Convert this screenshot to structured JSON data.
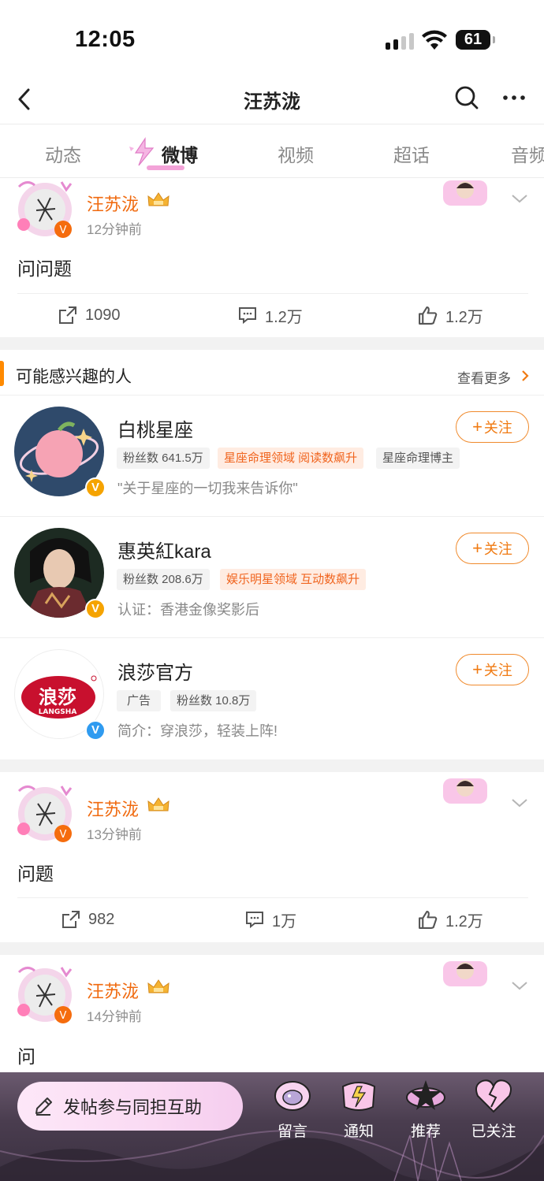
{
  "status_bar": {
    "time": "12:05",
    "battery": "61"
  },
  "nav": {
    "title": "汪苏泷"
  },
  "tabs": [
    {
      "label": "动态"
    },
    {
      "label": "微博"
    },
    {
      "label": "视频"
    },
    {
      "label": "超话"
    },
    {
      "label": "音频"
    }
  ],
  "posts": [
    {
      "user": "汪苏泷",
      "time": "12分钟前",
      "text": "问问题",
      "reposts": "1090",
      "comments": "1.2万",
      "likes": "1.2万"
    },
    {
      "user": "汪苏泷",
      "time": "13分钟前",
      "text": "问题",
      "reposts": "982",
      "comments": "1万",
      "likes": "1.2万"
    },
    {
      "user": "汪苏泷",
      "time": "14分钟前",
      "text": "问"
    }
  ],
  "recommend": {
    "title": "可能感兴趣的人",
    "more": "查看更多",
    "follow_label": "关注",
    "people": [
      {
        "name": "白桃星座",
        "tags": [
          "粉丝数 641.5万",
          "星座命理领域 阅读数飙升",
          "星座命理博主"
        ],
        "desc": "\"关于星座的一切我来告诉你\"",
        "badge": "V"
      },
      {
        "name": "惠英紅kara",
        "tags": [
          "粉丝数 208.6万",
          "娱乐明星领域 互动数飙升"
        ],
        "desc": "认证：香港金像奖影后",
        "badge": "V"
      },
      {
        "name": "浪莎官方",
        "tags": [
          "广告",
          "粉丝数 10.8万"
        ],
        "desc": "简介：穿浪莎，轻装上阵!",
        "badge": "V",
        "logo_text": "浪莎",
        "logo_sub": "LANGSHA"
      }
    ]
  },
  "bottom_bar": {
    "compose": "发帖参与同担互助",
    "items": [
      {
        "label": "留言",
        "icon": "message-icon"
      },
      {
        "label": "通知",
        "icon": "notification-icon"
      },
      {
        "label": "推荐",
        "icon": "recommend-icon"
      },
      {
        "label": "已关注",
        "icon": "followed-icon"
      }
    ]
  },
  "colors": {
    "accent_orange": "#f06a0f",
    "follow_orange": "#f07a12",
    "tab_highlight": "#f3a3d8",
    "verified_orange": "#f5a300",
    "verified_blue": "#2f9bf0"
  }
}
